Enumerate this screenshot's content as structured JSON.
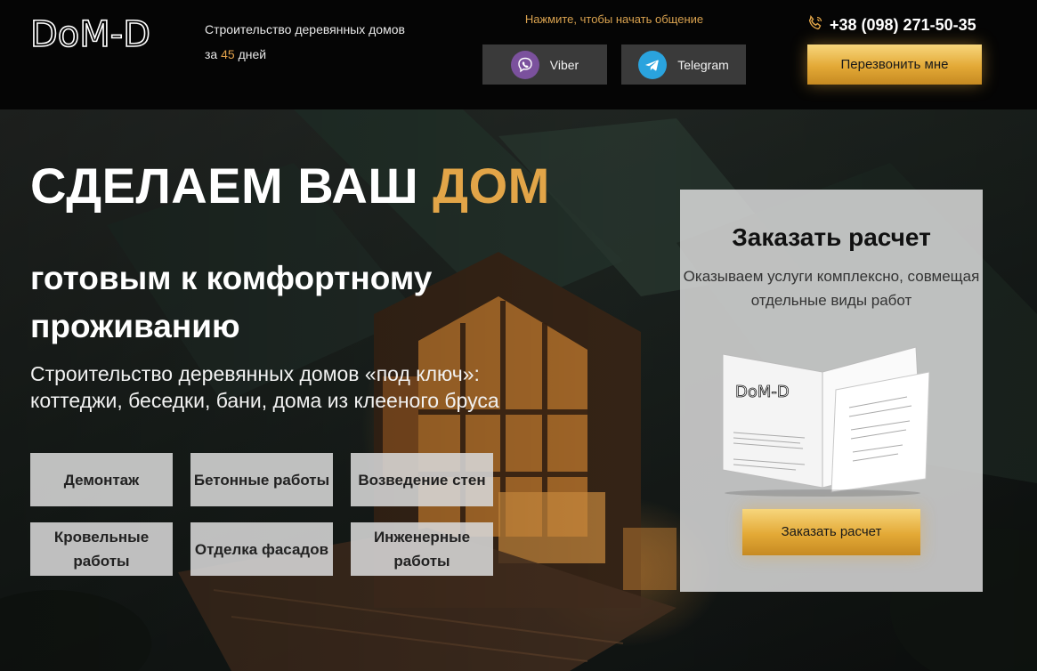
{
  "header": {
    "logo_text": "DoM-D",
    "tagline_line1": "Строительство деревянных домов",
    "tagline_prefix": "за",
    "tagline_days": "45",
    "tagline_suffix": "дней",
    "chat_prompt": "Нажмите, чтобы начать общение",
    "viber_label": "Viber",
    "telegram_label": "Telegram",
    "phone": "+38 (098) 271-50-35",
    "callback_label": "Перезвонить мне"
  },
  "hero": {
    "title_main": "СДЕЛАЕМ ВАШ",
    "title_accent": "ДОМ",
    "subtitle": "готовым к комфортному проживанию",
    "description": "Строительство деревянных домов «под ключ»: коттеджи, беседки, бани, дома из клееного бруса",
    "services": [
      "Демонтаж",
      "Бетонные работы",
      "Возведение стен",
      "Кровельные работы",
      "Отделка фасадов",
      "Инженерные работы"
    ]
  },
  "order_panel": {
    "title": "Заказать расчет",
    "description": "Оказываем услуги комплексно, совмещая отдельные виды работ",
    "book_logo": "DoM-D",
    "button_label": "Заказать расчет"
  },
  "colors": {
    "accent_gold": "#e2a548",
    "viber": "#7b519d",
    "telegram": "#2aa3de"
  },
  "icons": [
    "phone-icon",
    "viber-icon",
    "telegram-icon"
  ]
}
